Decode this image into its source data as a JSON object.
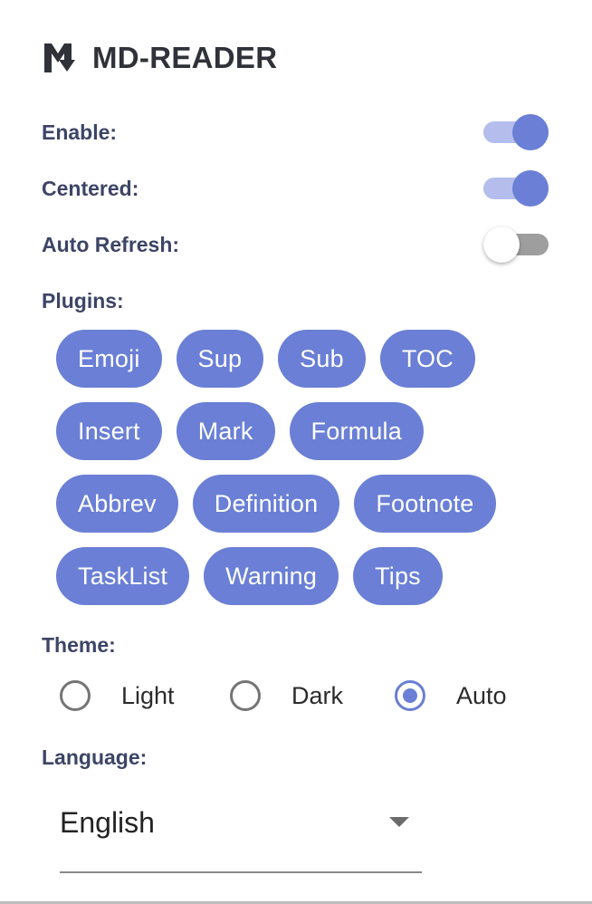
{
  "header": {
    "title": "MD-READER",
    "logo_icon": "markdown-logo-icon"
  },
  "settings": {
    "enable": {
      "label": "Enable:",
      "on": true
    },
    "centered": {
      "label": "Centered:",
      "on": true
    },
    "auto_refresh": {
      "label": "Auto Refresh:",
      "on": false
    }
  },
  "plugins": {
    "label": "Plugins:",
    "rows": [
      [
        "Emoji",
        "Sup",
        "Sub",
        "TOC"
      ],
      [
        "Insert",
        "Mark",
        "Formula"
      ],
      [
        "Abbrev",
        "Definition",
        "Footnote"
      ],
      [
        "TaskList",
        "Warning",
        "Tips"
      ]
    ]
  },
  "theme": {
    "label": "Theme:",
    "options": [
      "Light",
      "Dark",
      "Auto"
    ],
    "selected": "Auto"
  },
  "language": {
    "label": "Language:",
    "selected": "English"
  },
  "colors": {
    "accent": "#6a7fd5",
    "accent_light": "#b4bdec",
    "label_text": "#3c4566",
    "toggle_off_track": "#9e9e9e"
  }
}
